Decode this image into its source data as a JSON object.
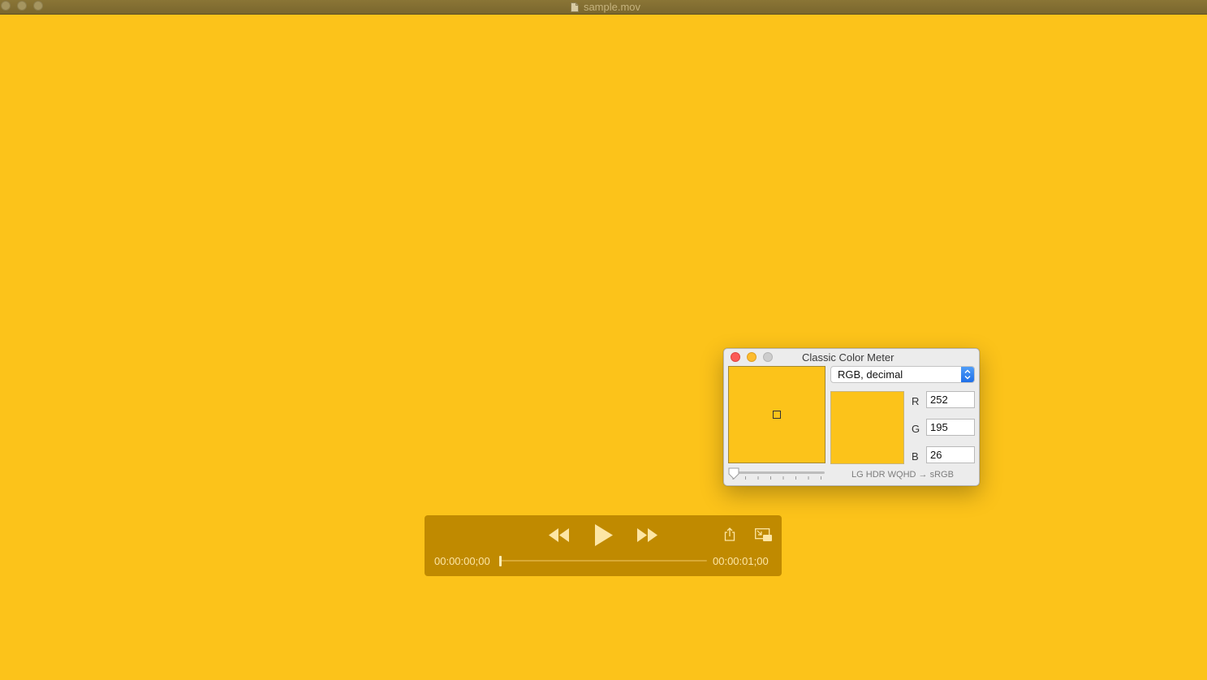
{
  "window": {
    "title": "sample.mov",
    "buttons": [
      "close-icon",
      "minimize-icon",
      "zoom-icon"
    ]
  },
  "video": {
    "frame_color": "#fcc31a"
  },
  "controls": {
    "current_time": "00:00:00;00",
    "duration": "00:00:01;00",
    "progress": 0,
    "icons": [
      "rewind-icon",
      "play-icon",
      "fast-forward-icon",
      "share-icon",
      "picture-in-picture-icon"
    ]
  },
  "color_meter": {
    "title": "Classic Color Meter",
    "mode": "RGB, decimal",
    "channels": [
      {
        "label": "R",
        "value": "252"
      },
      {
        "label": "G",
        "value": "195"
      },
      {
        "label": "B",
        "value": "26"
      }
    ],
    "profile": "LG HDR WQHD → sRGB",
    "aperture_level": 0,
    "sample_color": "#fcc31a"
  },
  "colors": {
    "accent_blue": "#2a7cf0",
    "close_red": "#fc5b57",
    "minimize_yellow": "#fdbc2e",
    "controls_bg": "#c08a00"
  }
}
